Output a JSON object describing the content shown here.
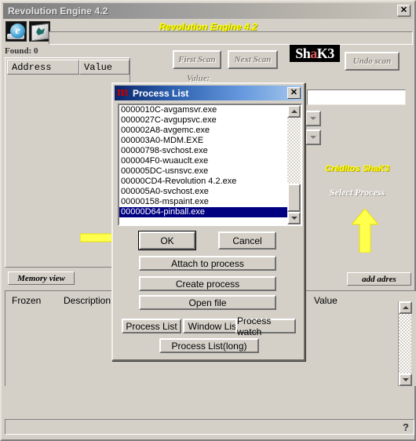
{
  "window": {
    "title": "Revolution Engine 4.2",
    "close_label": "✕",
    "banner_title": "Revolution Engine 4.2",
    "found_label": "Found: 0",
    "status_help": "?"
  },
  "toolbar": {
    "icons": [
      {
        "name": "internet-explorer-icon",
        "glyph": "e"
      },
      {
        "name": "paint-document-icon",
        "glyph": ""
      }
    ]
  },
  "results": {
    "columns": [
      "Address",
      "Value"
    ],
    "memory_view_label": "Memory view",
    "frozen_header": "Frozen",
    "description_header": "Description",
    "value_header": "Value"
  },
  "scan": {
    "first_scan": "First Scan",
    "next_scan": "Next Scan",
    "undo_scan": "Undo scan",
    "value_label": "Value:",
    "logo_prefix": "Sh",
    "logo_accent": "a",
    "logo_suffix": "K3"
  },
  "right_panel": {
    "creditos": "Créditos ShaK3",
    "select_process": "Select Process",
    "add_adres": "add adres"
  },
  "dialog": {
    "title": "Process List",
    "close_label": "✕",
    "processes": [
      "0000010C-avgamsvr.exe",
      "0000027C-avgupsvc.exe",
      "000002A8-avgemc.exe",
      "000003A0-MDM.EXE",
      "00000798-svchost.exe",
      "000004F0-wuauclt.exe",
      "000005DC-usnsvc.exe",
      "00000CD4-Revolution 4.2.exe",
      "000005A0-svchost.exe",
      "00000158-mspaint.exe",
      "00000D64-pinball.exe"
    ],
    "selected_index": 10,
    "buttons": {
      "ok": "OK",
      "cancel": "Cancel",
      "attach": "Attach to process",
      "create": "Create process",
      "open_file": "Open file",
      "process_list": "Process List",
      "window_list": "Window List",
      "process_watch": "Process watch",
      "process_list_long": "Process List(long)"
    }
  },
  "colors": {
    "face": "#d4d0c8",
    "highlight": "#000080",
    "accent_yellow": "#ffff00",
    "dialog_title_start": "#0a246a",
    "dialog_title_end": "#a6c8ee"
  }
}
